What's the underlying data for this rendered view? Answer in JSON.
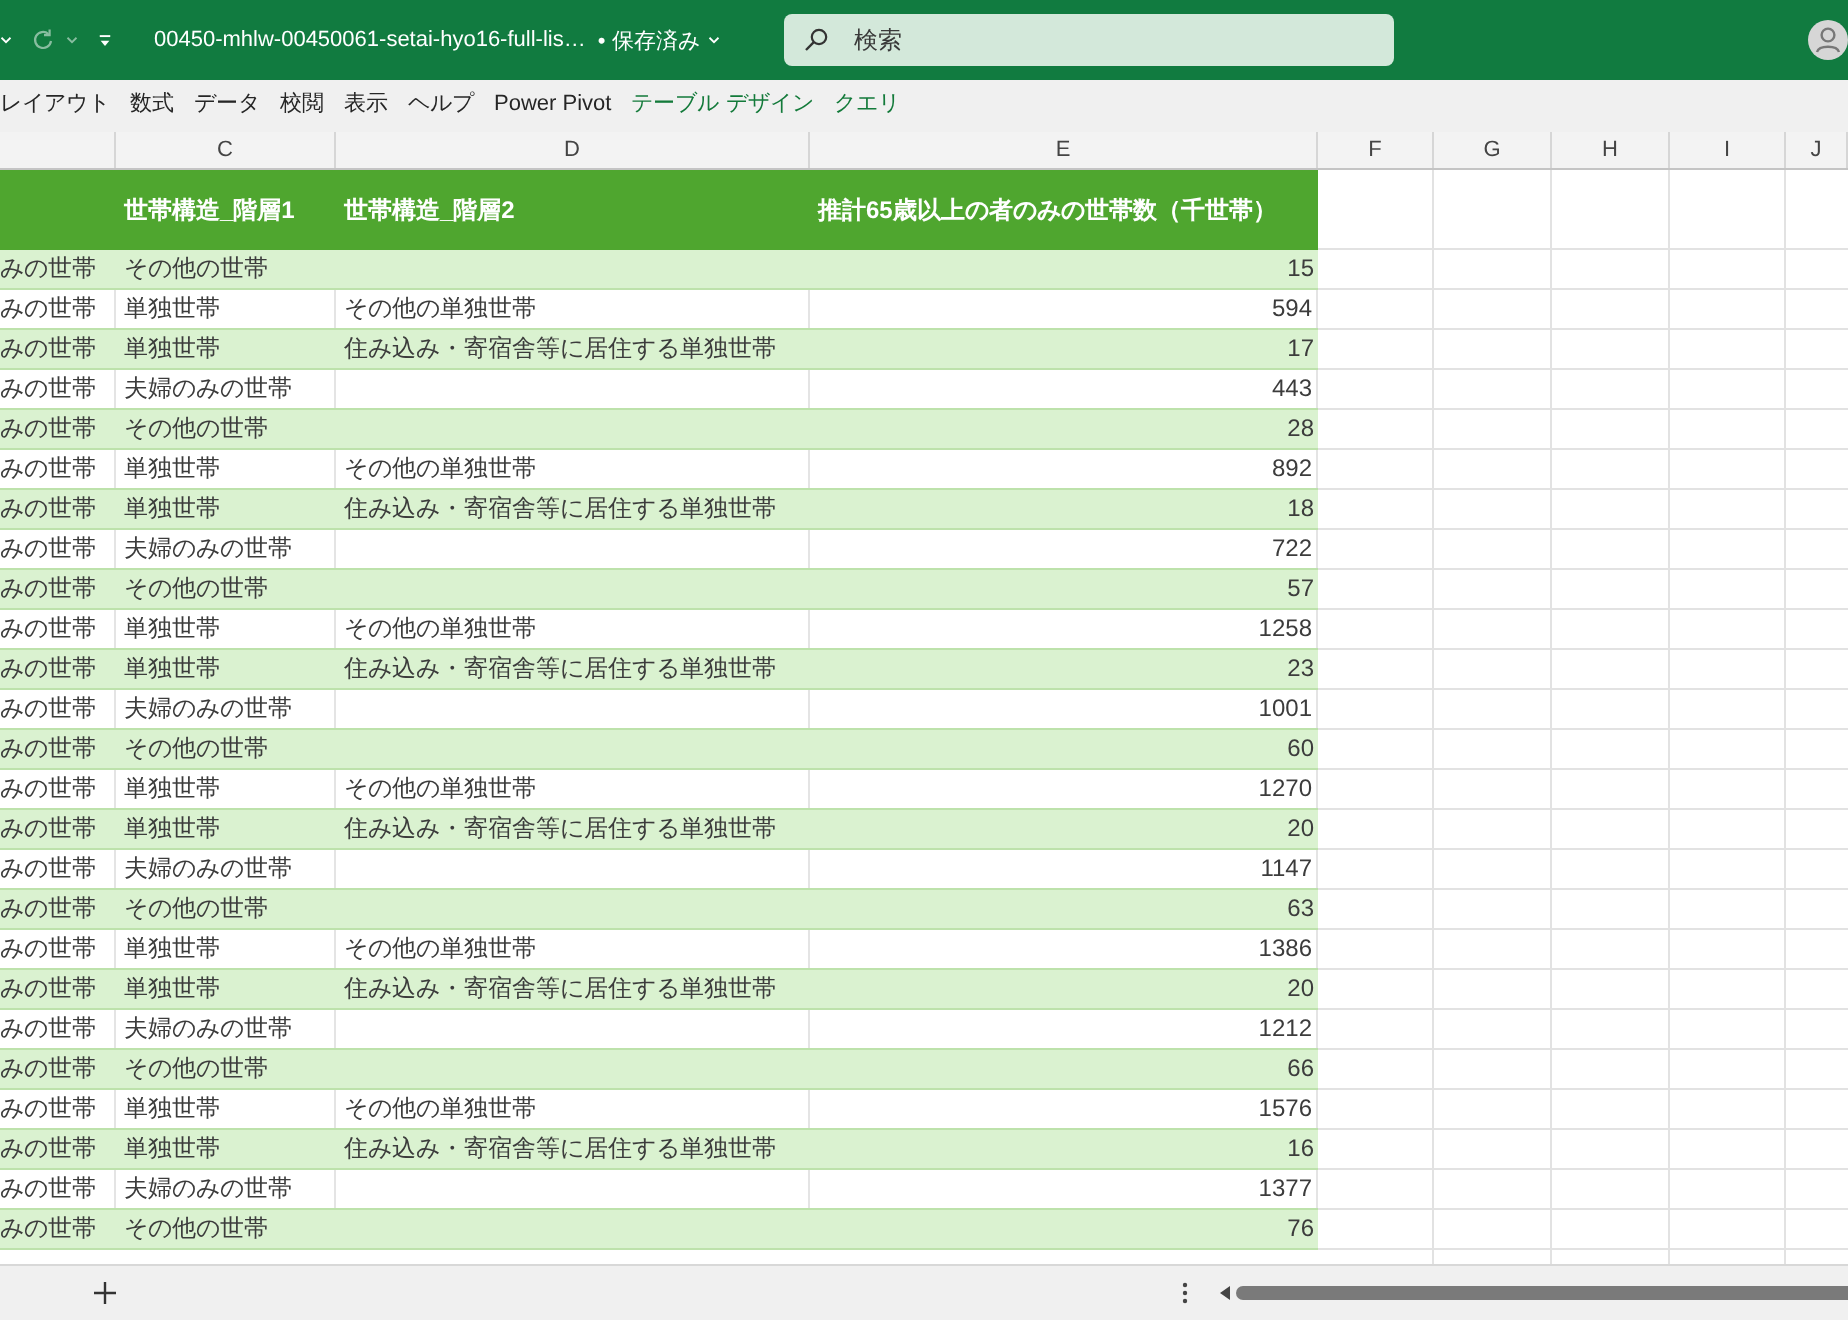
{
  "title_bar": {
    "quick_access": {
      "redo": {
        "disabled": true
      }
    },
    "document_title": "00450-mhlw-00450061-setai-hyo16-full-lis…",
    "save_status": "• 保存済み",
    "search": {
      "placeholder": "検索"
    }
  },
  "ribbon_tabs": [
    {
      "label": "レイアウト",
      "kind": "standard",
      "selected": false
    },
    {
      "label": "数式",
      "kind": "standard",
      "selected": false
    },
    {
      "label": "データ",
      "kind": "standard",
      "selected": false
    },
    {
      "label": "校閲",
      "kind": "standard",
      "selected": false
    },
    {
      "label": "表示",
      "kind": "standard",
      "selected": false
    },
    {
      "label": "ヘルプ",
      "kind": "standard",
      "selected": false
    },
    {
      "label": "Power Pivot",
      "kind": "standard",
      "selected": false
    },
    {
      "label": "テーブル デザイン",
      "kind": "contextual",
      "selected": false
    },
    {
      "label": "クエリ",
      "kind": "contextual",
      "selected": false
    }
  ],
  "sheet": {
    "column_letters": [
      "C",
      "D",
      "E",
      "F",
      "G",
      "H",
      "I",
      "J"
    ],
    "table": {
      "headers": {
        "level_1": "世帯構造_階層1",
        "level_2": "世帯構造_階層2",
        "households": "推計65歳以上の者のみの世帯数（千世帯）"
      },
      "rows": [
        {
          "column_1": "みの世帯",
          "level_1": "その他の世帯",
          "households": "15"
        },
        {
          "column_1": "みの世帯",
          "level_1": "単独世帯",
          "level_2": "その他の単独世帯",
          "households": "594"
        },
        {
          "column_1": "みの世帯",
          "level_1": "単独世帯",
          "level_2": "住み込み・寄宿舎等に居住する単独世帯",
          "households": "17"
        },
        {
          "column_1": "みの世帯",
          "level_1": "夫婦のみの世帯",
          "households": "443"
        },
        {
          "column_1": "みの世帯",
          "level_1": "その他の世帯",
          "households": "28"
        },
        {
          "column_1": "みの世帯",
          "level_1": "単独世帯",
          "level_2": "その他の単独世帯",
          "households": "892"
        },
        {
          "column_1": "みの世帯",
          "level_1": "単独世帯",
          "level_2": "住み込み・寄宿舎等に居住する単独世帯",
          "households": "18"
        },
        {
          "column_1": "みの世帯",
          "level_1": "夫婦のみの世帯",
          "households": "722"
        },
        {
          "column_1": "みの世帯",
          "level_1": "その他の世帯",
          "households": "57"
        },
        {
          "column_1": "みの世帯",
          "level_1": "単独世帯",
          "level_2": "その他の単独世帯",
          "households": "1258"
        },
        {
          "column_1": "みの世帯",
          "level_1": "単独世帯",
          "level_2": "住み込み・寄宿舎等に居住する単独世帯",
          "households": "23"
        },
        {
          "column_1": "みの世帯",
          "level_1": "夫婦のみの世帯",
          "households": "1001"
        },
        {
          "column_1": "みの世帯",
          "level_1": "その他の世帯",
          "households": "60"
        },
        {
          "column_1": "みの世帯",
          "level_1": "単独世帯",
          "level_2": "その他の単独世帯",
          "households": "1270"
        },
        {
          "column_1": "みの世帯",
          "level_1": "単独世帯",
          "level_2": "住み込み・寄宿舎等に居住する単独世帯",
          "households": "20"
        },
        {
          "column_1": "みの世帯",
          "level_1": "夫婦のみの世帯",
          "households": "1147"
        },
        {
          "column_1": "みの世帯",
          "level_1": "その他の世帯",
          "households": "63"
        },
        {
          "column_1": "みの世帯",
          "level_1": "単独世帯",
          "level_2": "その他の単独世帯",
          "households": "1386"
        },
        {
          "column_1": "みの世帯",
          "level_1": "単独世帯",
          "level_2": "住み込み・寄宿舎等に居住する単独世帯",
          "households": "20"
        },
        {
          "column_1": "みの世帯",
          "level_1": "夫婦のみの世帯",
          "households": "1212"
        },
        {
          "column_1": "みの世帯",
          "level_1": "その他の世帯",
          "households": "66"
        },
        {
          "column_1": "みの世帯",
          "level_1": "単独世帯",
          "level_2": "その他の単独世帯",
          "households": "1576"
        },
        {
          "column_1": "みの世帯",
          "level_1": "単独世帯",
          "level_2": "住み込み・寄宿舎等に居住する単独世帯",
          "households": "16"
        },
        {
          "column_1": "みの世帯",
          "level_1": "夫婦のみの世帯",
          "households": "1377"
        },
        {
          "column_1": "みの世帯",
          "level_1": "その他の世帯",
          "households": "76"
        }
      ]
    }
  }
}
